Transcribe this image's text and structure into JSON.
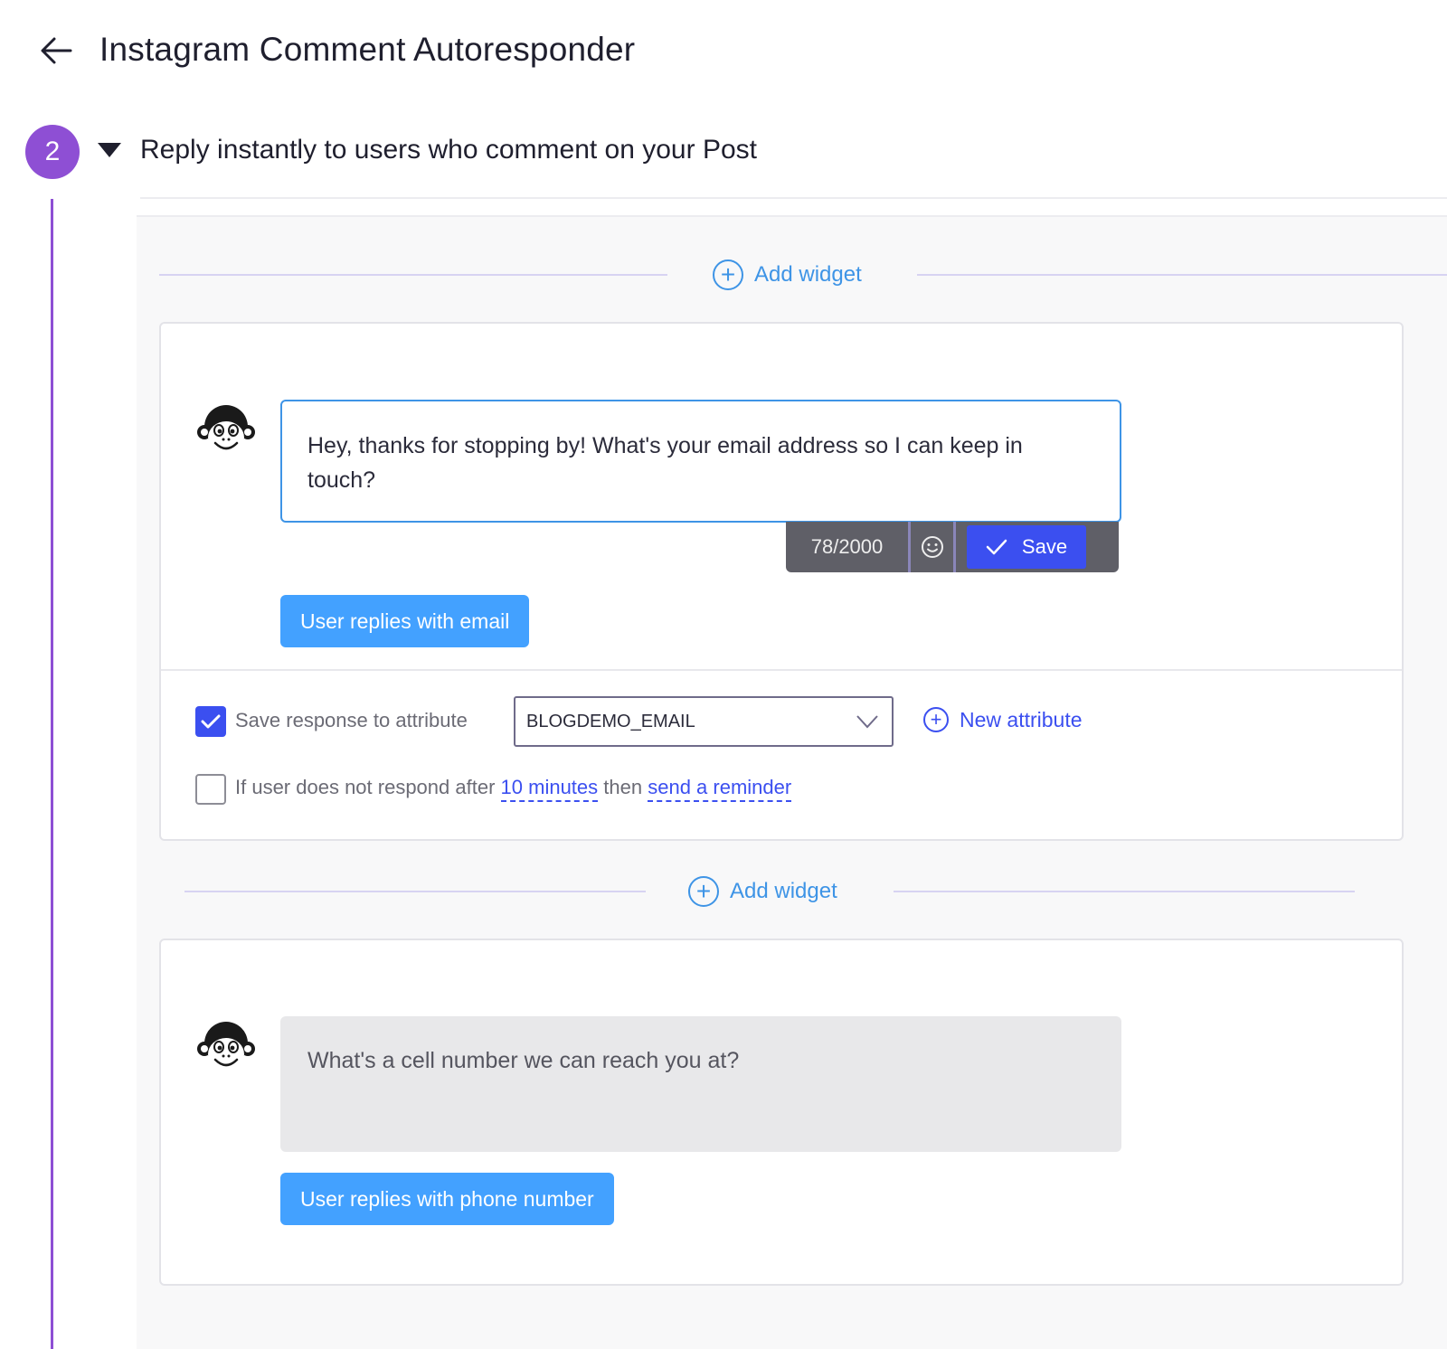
{
  "header": {
    "title": "Instagram Comment Autoresponder"
  },
  "step": {
    "number": "2",
    "title": "Reply instantly to users who comment on your Post"
  },
  "add_widget_label": "Add widget",
  "widgets": [
    {
      "message": "Hey, thanks for stopping by! What's your email address so I can keep in touch?",
      "char_count": "78/2000",
      "save_label": "Save",
      "reply_button": "User replies with email",
      "save_response_label": "Save response to attribute",
      "save_response_checked": true,
      "attribute_value": "BLOGDEMO_EMAIL",
      "new_attribute_label": "New attribute",
      "reminder": {
        "checked": false,
        "prefix": "If user does not respond after",
        "duration": "10 minutes",
        "middle": "then",
        "action": "send a reminder"
      }
    },
    {
      "message": "What's a cell number we can reach you at?",
      "reply_button": "User replies with phone number"
    }
  ],
  "colors": {
    "step_badge": "#8e4fd4",
    "accent_blue": "#3e94e6",
    "save_button": "#3b4ff0",
    "reply_button": "#43a1ff",
    "toolbar": "#5f5f67"
  },
  "icons": {
    "back": "arrow-left-icon",
    "collapse": "caret-down-icon",
    "add": "plus-circle-icon",
    "avatar": "monkey-mascot-icon",
    "emoji": "smiley-icon",
    "save": "checkmark-icon",
    "dropdown": "chevron-down-icon"
  }
}
